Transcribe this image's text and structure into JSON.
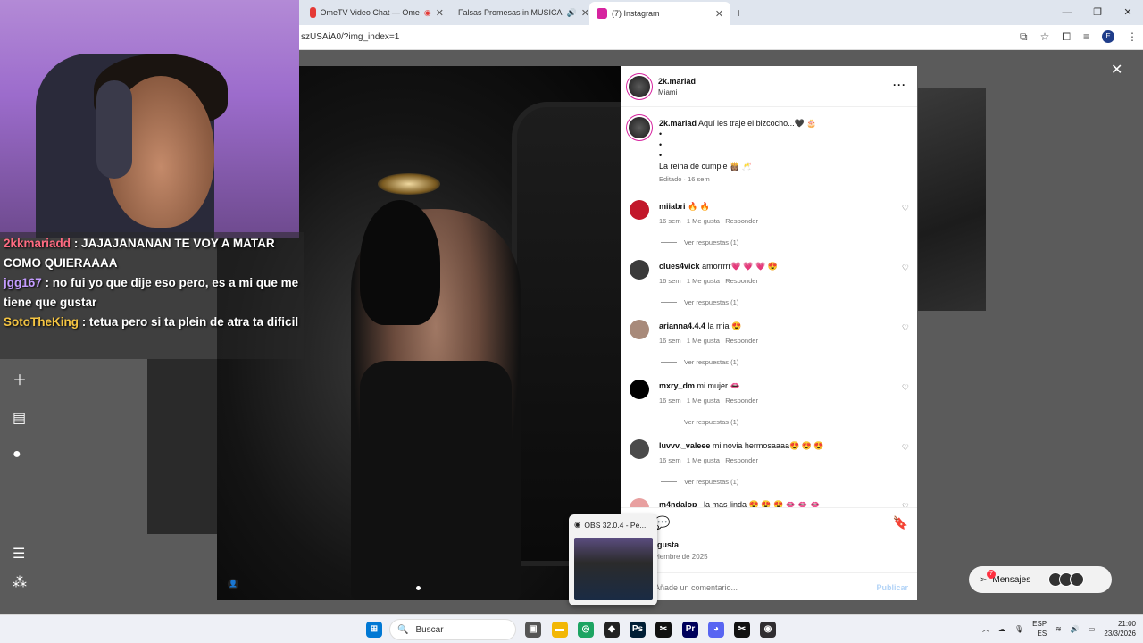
{
  "browser": {
    "tabs": [
      {
        "label": "OmeTV Video Chat — Ome",
        "icon": "ometv-icon",
        "color": "#e53935"
      },
      {
        "label": "Falsas Promesas in MUSICA",
        "icon": "youtube-icon",
        "color": "#ff0000"
      },
      {
        "label": "(7) Instagram",
        "icon": "instagram-icon",
        "color": "#d6249f"
      }
    ],
    "new_tab": "+",
    "url": "szUSAiA0/?img_index=1",
    "profile_initial": "E"
  },
  "post": {
    "username": "2k.mariad",
    "location": "Miami",
    "caption_user": "2k.mariad",
    "caption_text": "Aquí les traje el bizcocho...🖤 🎂",
    "bullets": [
      "•",
      "•",
      "•"
    ],
    "caption_line": "La reina de cumple 👸🏽 🥂",
    "caption_meta": "Editado · 16 sem",
    "likes_label": "gusta",
    "date": "viembre de 2025",
    "comment_placeholder": "Añade un comentario...",
    "publish": "Publicar"
  },
  "comments": [
    {
      "user": "miiabri",
      "text": "🔥 🔥",
      "time": "16 sem",
      "likes": "1 Me gusta",
      "reply": "Responder",
      "replies": "Ver respuestas (1)",
      "avatar_color": "#c2182b"
    },
    {
      "user": "clues4vick",
      "text": "amorrrrr💗 💗 💗 😍",
      "time": "16 sem",
      "likes": "1 Me gusta",
      "reply": "Responder",
      "replies": "Ver respuestas (1)",
      "avatar_color": "#3b3b3b"
    },
    {
      "user": "arianna4.4.4",
      "text": "la mia 😍",
      "time": "16 sem",
      "likes": "1 Me gusta",
      "reply": "Responder",
      "replies": "Ver respuestas (1)",
      "avatar_color": "#a88a7a"
    },
    {
      "user": "mxry_dm",
      "text": "mi mujer 👄",
      "time": "16 sem",
      "likes": "1 Me gusta",
      "reply": "Responder",
      "replies": "Ver respuestas (1)",
      "avatar_color": "#000000"
    },
    {
      "user": "luvvv._valeee",
      "text": "mi novia hermosaaaa😍 😍 😍",
      "time": "16 sem",
      "likes": "1 Me gusta",
      "reply": "Responder",
      "replies": "Ver respuestas (1)",
      "avatar_color": "#4a4a4a"
    },
    {
      "user": "m4ndalop_",
      "text": "la mas linda 😍 😍 😍 👄 👄 👄",
      "time": "",
      "likes": "",
      "reply": "",
      "replies": "",
      "avatar_color": "#e8a0a0"
    }
  ],
  "stream_chat": [
    {
      "user": "2kkmariadd",
      "text": ": JAJAJANANAN TE VOY A MATAR COMO QUIERAAAA",
      "color": "#ff6b81"
    },
    {
      "user": "jgg167",
      "text": ": no fui yo que dije eso pero, es a mi que me tiene que gustar",
      "color": "#c49cff"
    },
    {
      "user": "SotoTheKing",
      "text": ": tetua pero si ta plein de atra ta dificil",
      "color": "#f5c542"
    }
  ],
  "obs_thumb": {
    "title": "OBS 32.0.4 - Pe..."
  },
  "messages": {
    "label": "Mensajes",
    "badge": "7"
  },
  "taskbar": {
    "search": "Buscar",
    "lang_top": "ESP",
    "lang_bottom": "ES",
    "time": "21:00",
    "date": "23/3/2026"
  }
}
